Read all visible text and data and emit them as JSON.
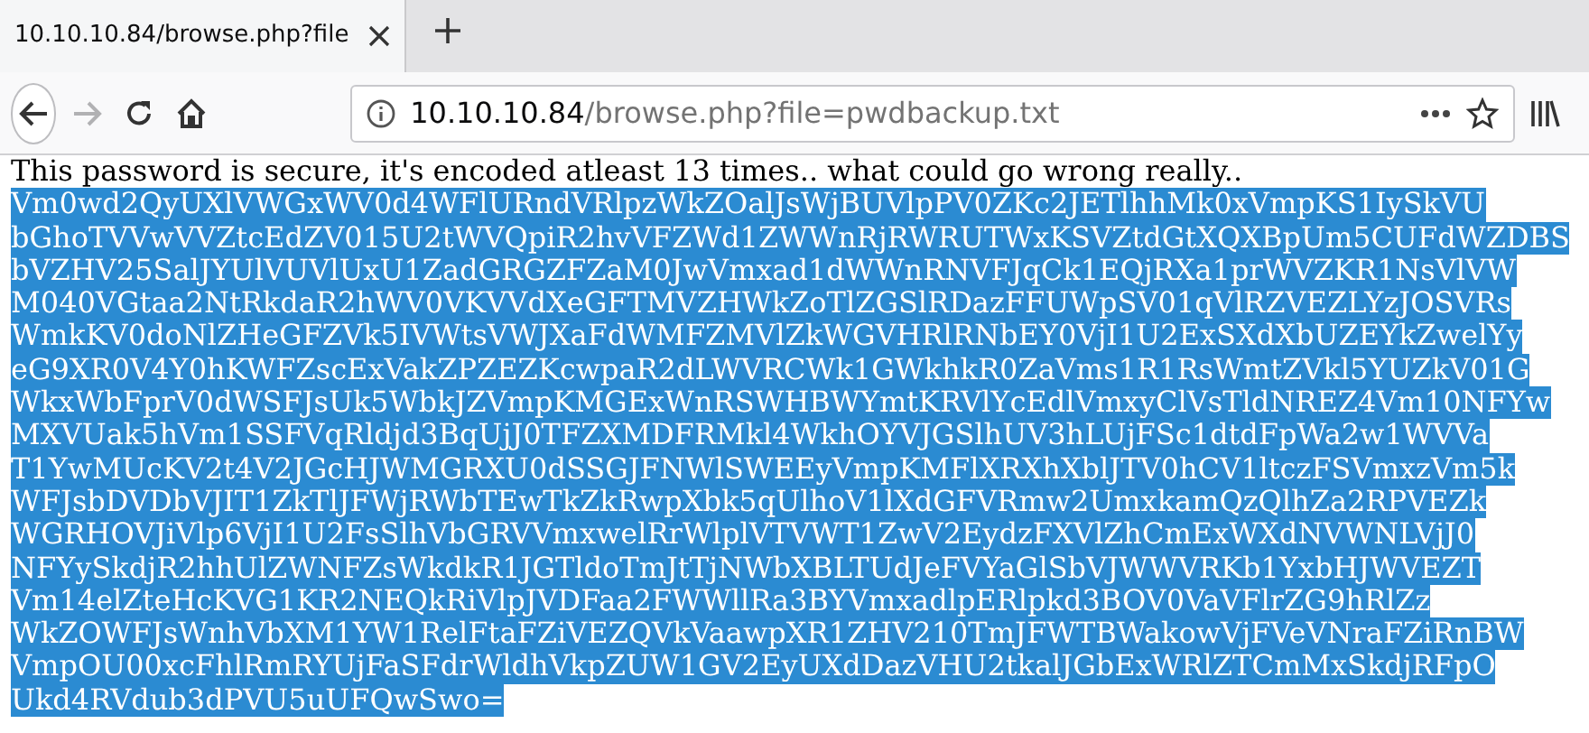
{
  "tab": {
    "title": "10.10.10.84/browse.php?file",
    "selected": true
  },
  "address_bar": {
    "host": "10.10.10.84",
    "path": "/browse.php?file=pwdbackup.txt"
  },
  "toolbar": {
    "forward_disabled": true
  },
  "page": {
    "intro": "This password is secure, it's encoded atleast 13 times.. what could go wrong really..",
    "selected": true,
    "lines": [
      "Vm0wd2QyUXlVWGxWV0d4WFlURndVRlpzWkZOalJsWjBUVlpPV0ZKc2JETlhhMk0xVmpKS1IySkVU",
      "bGhoTVVwVVZtcEdZV015U2tWVQpiR2hvVFZWd1ZWWnRjRWRUTWxKSVZtdGtXQXBpUm5CUFdWZDBS",
      "bVZHV25SalJYUlVUVlUxU1ZadGRGZFZaM0JwVmxad1dWWnRNVFJqCk1EQjRXa1prWVZKR1NsVlVW",
      "M040VGtaa2NtRkdaR2hWV0VKVVdXeGFTMVZHWkZoTlZGSlRDazFFUWpSV01qVlRZVEZLYzJOSVRs",
      "WmkKV0doNlZHeGFZVk5IVWtsVWJXaFdWMFZMVlZkWGVHRlRNbEY0VjI1U2ExSXdXbUZEYkZwelYy",
      "eG9XR0V4Y0hKWFZscExVakZPZEZKcwpaR2dLWVRCWk1GWkhkR0ZaVms1R1RsWmtZVkl5YUZkV01G",
      "WkxWbFprV0dWSFJsUk5WbkJZVmpKMGExWnRSWHBWYmtKRVlYcEdlVmxyClVsTldNREZ4Vm10NFYw",
      "MXVUak5hVm1SSFVqRldjd3BqUjJ0TFZXMDFRMkl4WkhOYVJGSlhUV3hLUjFSc1dtdFpWa2w1WVVa",
      "T1YwMUcKV2t4V2JGcHJWMGRXU0dSSGJFNWlSWEEyVmpKMFlXRXhXblJTV0hCV1ltczFSVmxzVm5k",
      "WFJsbDVDbVJIT1ZkTlJFWjRWbTEwTkZkRwpXbk5qUlhoV1lXdGFVRmw2UmxkamQzQlhZa2RPVEZk",
      "WGRHOVJiVlp6VjI1U2FsSlhVbGRVVmxwelRrWlplVTVWT1ZwV2EydzFXVlZhCmExWXdNVWNLVjJ0",
      "NFYySkdjR2hhUlZWNFZsWkdkR1JGTldoTmJtTjNWbXBLTUdJeFVYaGlSbVJWWVRKb1YxbHJWVEZT",
      "Vm14elZteHcKVG1KR2NEQkRiVlpJVDFaa2FWWllRa3BYVmxadlpERlpkd3BOV0VaVFlrZG9hRlZz",
      "WkZOWFJsWnhVbXM1YW1RelFtaFZiVEZQVkVaawpXR1ZHV210TmJFWTBWakowVjFVeVNraFZiRnBW",
      "VmpOU00xcFhlRmRYUjFaSFdrWldhVkpZUW1GV2EyUXdDazVHU2tkalJGbExWRlZTCmMxSkdjRFpO",
      "Ukd4RVdub3dPVU5uUFQwSwo="
    ]
  }
}
